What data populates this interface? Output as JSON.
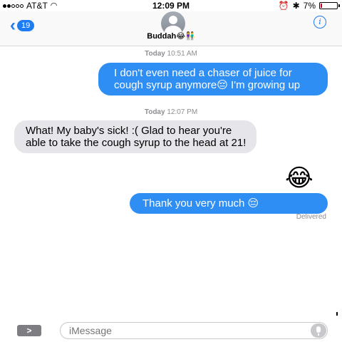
{
  "status_bar": {
    "carrier": "AT&T",
    "time": "12:09 PM",
    "battery": "7%",
    "battery_level": 0.07,
    "accent_battery": "#d0021b"
  },
  "nav": {
    "back_count": "19",
    "contact_name": "Buddah😂👫",
    "info_label": "i"
  },
  "messages": {
    "ts1_day": "Today",
    "ts1_time": "10:51 AM",
    "msg1": "I don't even need a chaser of juice for cough syrup anymore😔 I'm growing up",
    "ts2_day": "Today",
    "ts2_time": "12:07 PM",
    "msg2": "What! My baby's sick! :( Glad to hear you're able to take the cough syrup to the head at 21!",
    "emoji_reply": "😂",
    "msg3": "Thank you very much 😔",
    "delivered": "Delivered"
  },
  "input": {
    "placeholder": "iMessage",
    "expand_label": ">"
  },
  "colors": {
    "sent_bubble": "#2f8ef3",
    "received_bubble": "#e5e5ea",
    "ios_blue": "#1d7cf2"
  }
}
